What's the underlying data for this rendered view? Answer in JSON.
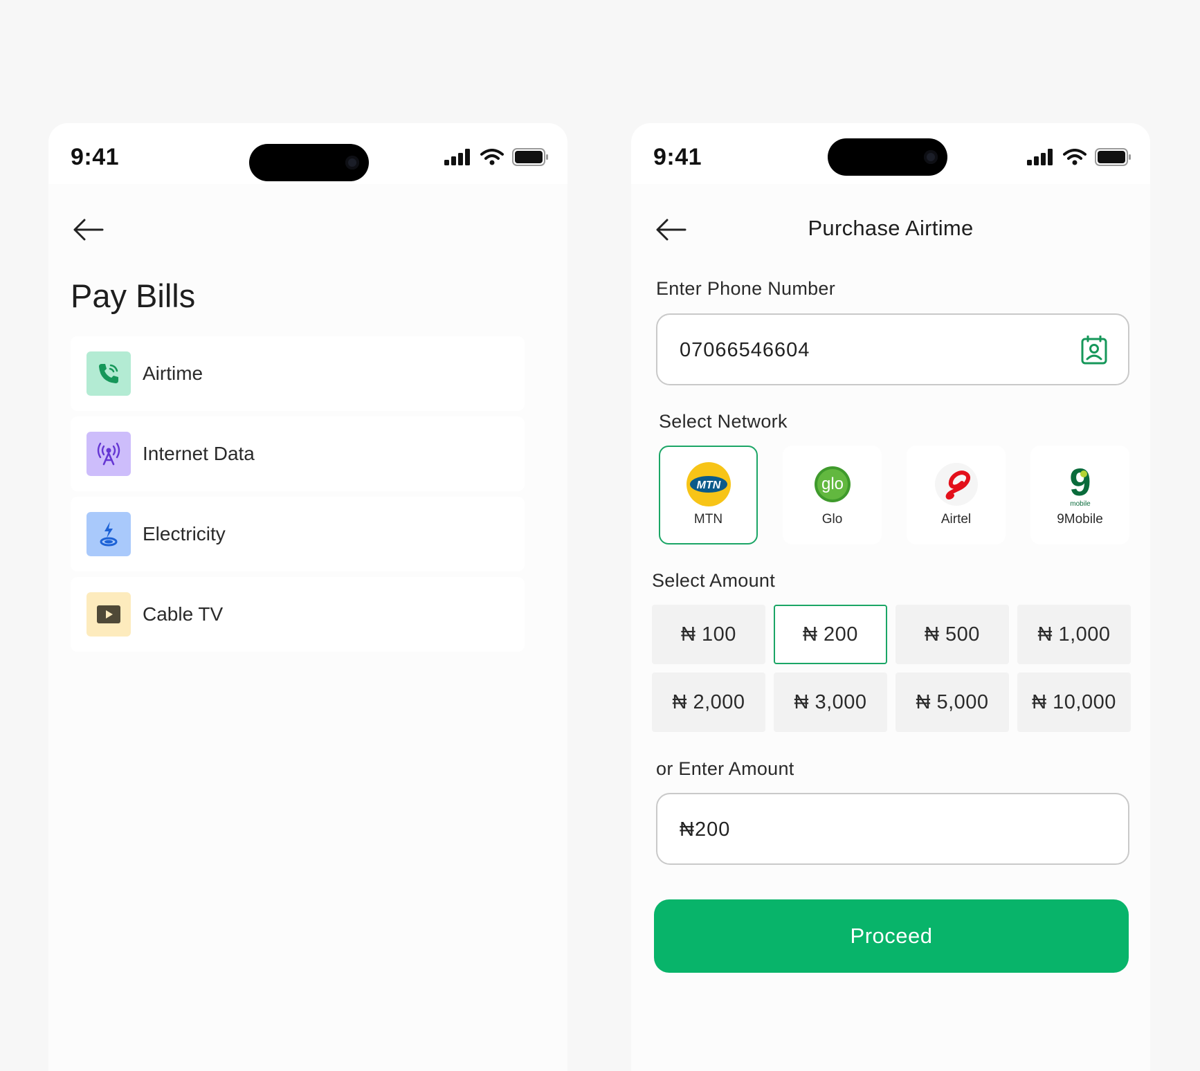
{
  "colors": {
    "accent": "#08b46a",
    "selected_border": "#1aa565",
    "background": "#f7f7f7"
  },
  "left_screen": {
    "status_time": "9:41",
    "title": "Pay Bills",
    "items": [
      {
        "label": "Airtime",
        "icon": "phone-call-icon",
        "color": "#b3ebd3"
      },
      {
        "label": "Internet Data",
        "icon": "antenna-icon",
        "color": "#cdbdfb"
      },
      {
        "label": "Electricity",
        "icon": "lightning-icon",
        "color": "#a9c9fb"
      },
      {
        "label": "Cable TV",
        "icon": "play-icon",
        "color": "#fdebbd"
      }
    ]
  },
  "right_screen": {
    "status_time": "9:41",
    "title": "Purchase Airtime",
    "phone_label": "Enter Phone Number",
    "phone_value": "07066546604",
    "network_label": "Select Network",
    "networks": [
      {
        "name": "MTN",
        "logo_text": "MTN",
        "selected": true
      },
      {
        "name": "Glo",
        "logo_text": "glo",
        "selected": false
      },
      {
        "name": "Airtel",
        "selected": false
      },
      {
        "name": "9Mobile",
        "logo_text": "9",
        "logo_subtext": "mobile",
        "selected": false
      }
    ],
    "amount_label": "Select Amount",
    "amounts": [
      "₦ 100",
      "₦ 200",
      "₦ 500",
      "₦ 1,000",
      "₦ 2,000",
      "₦ 3,000",
      "₦ 5,000",
      "₦ 10,000"
    ],
    "selected_amount_index": 1,
    "enter_amount_label": "or Enter Amount",
    "enter_amount_value": "₦200",
    "proceed_label": "Proceed"
  }
}
